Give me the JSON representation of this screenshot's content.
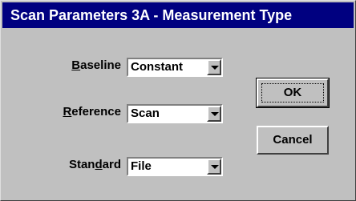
{
  "window": {
    "title": "Scan Parameters 3A - Measurement Type"
  },
  "fields": [
    {
      "label_pre": "",
      "label_key": "B",
      "label_post": "aseline",
      "value": "Constant"
    },
    {
      "label_pre": "",
      "label_key": "R",
      "label_post": "eference",
      "value": "Scan"
    },
    {
      "label_pre": "Stan",
      "label_key": "d",
      "label_post": "ard",
      "value": "File"
    }
  ],
  "buttons": {
    "ok_label": "OK",
    "cancel_label": "Cancel"
  },
  "colors": {
    "titlebar": "#000080",
    "face": "#c0c0c0"
  }
}
